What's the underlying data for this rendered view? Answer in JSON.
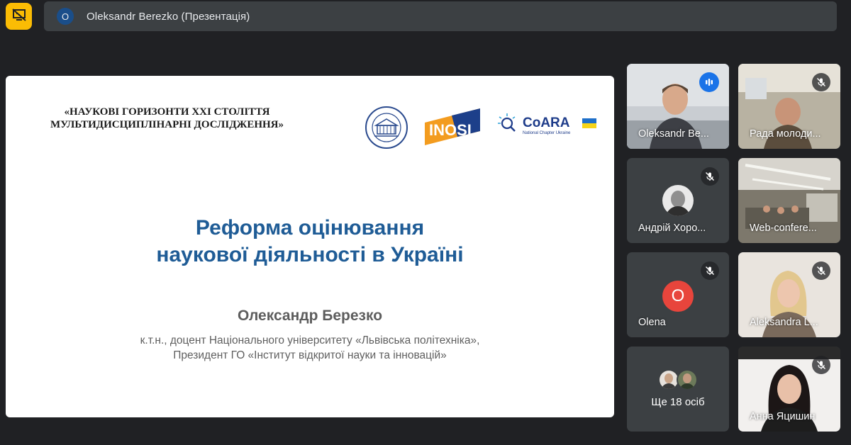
{
  "toolbar": {
    "present_icon": "presentation-off-icon",
    "presenter_initial": "O",
    "presenter_title": "Oleksandr Berezko (Презентація)"
  },
  "slide": {
    "conf_line1": "«НАУКОВІ ГОРИЗОНТИ XXI СТОЛІТТЯ",
    "conf_line2": "МУЛЬТИДИСЦИПЛІНАРНІ ДОСЛІДЖЕННЯ»",
    "inosi_logo": "INOSI",
    "coara_logo": "CoARA",
    "coara_sub": "National Chapter Ukraine",
    "title_line1": "Реформа оцінювання",
    "title_line2": "наукової діяльності в Україні",
    "author": "Олександр Березко",
    "affiliation_line1": "к.т.н., доцент Національного університету «Львівська політехніка»,",
    "affiliation_line2": "Президент ГО «Інститут відкритої науки та інновацій»",
    "title_color": "#1f5c96"
  },
  "participants": [
    {
      "name": "Oleksandr Ве...",
      "state": "speaking"
    },
    {
      "name": "Рада молоди...",
      "state": "muted"
    },
    {
      "name": "Андрій Хоро...",
      "state": "muted"
    },
    {
      "name": "Web-confere...",
      "state": "video"
    },
    {
      "name": "Olena",
      "initial": "O",
      "state": "muted"
    },
    {
      "name": "Aleksandra L...",
      "state": "muted"
    },
    {
      "more_label": "Ще 18 осіб"
    },
    {
      "name": "Анна Яцишин",
      "state": "muted"
    }
  ],
  "colors": {
    "background": "#202124",
    "tile": "#3c4043",
    "accent": "#fbbc04",
    "active_border": "#8ab4f8",
    "avatar_red": "#e8453c"
  }
}
